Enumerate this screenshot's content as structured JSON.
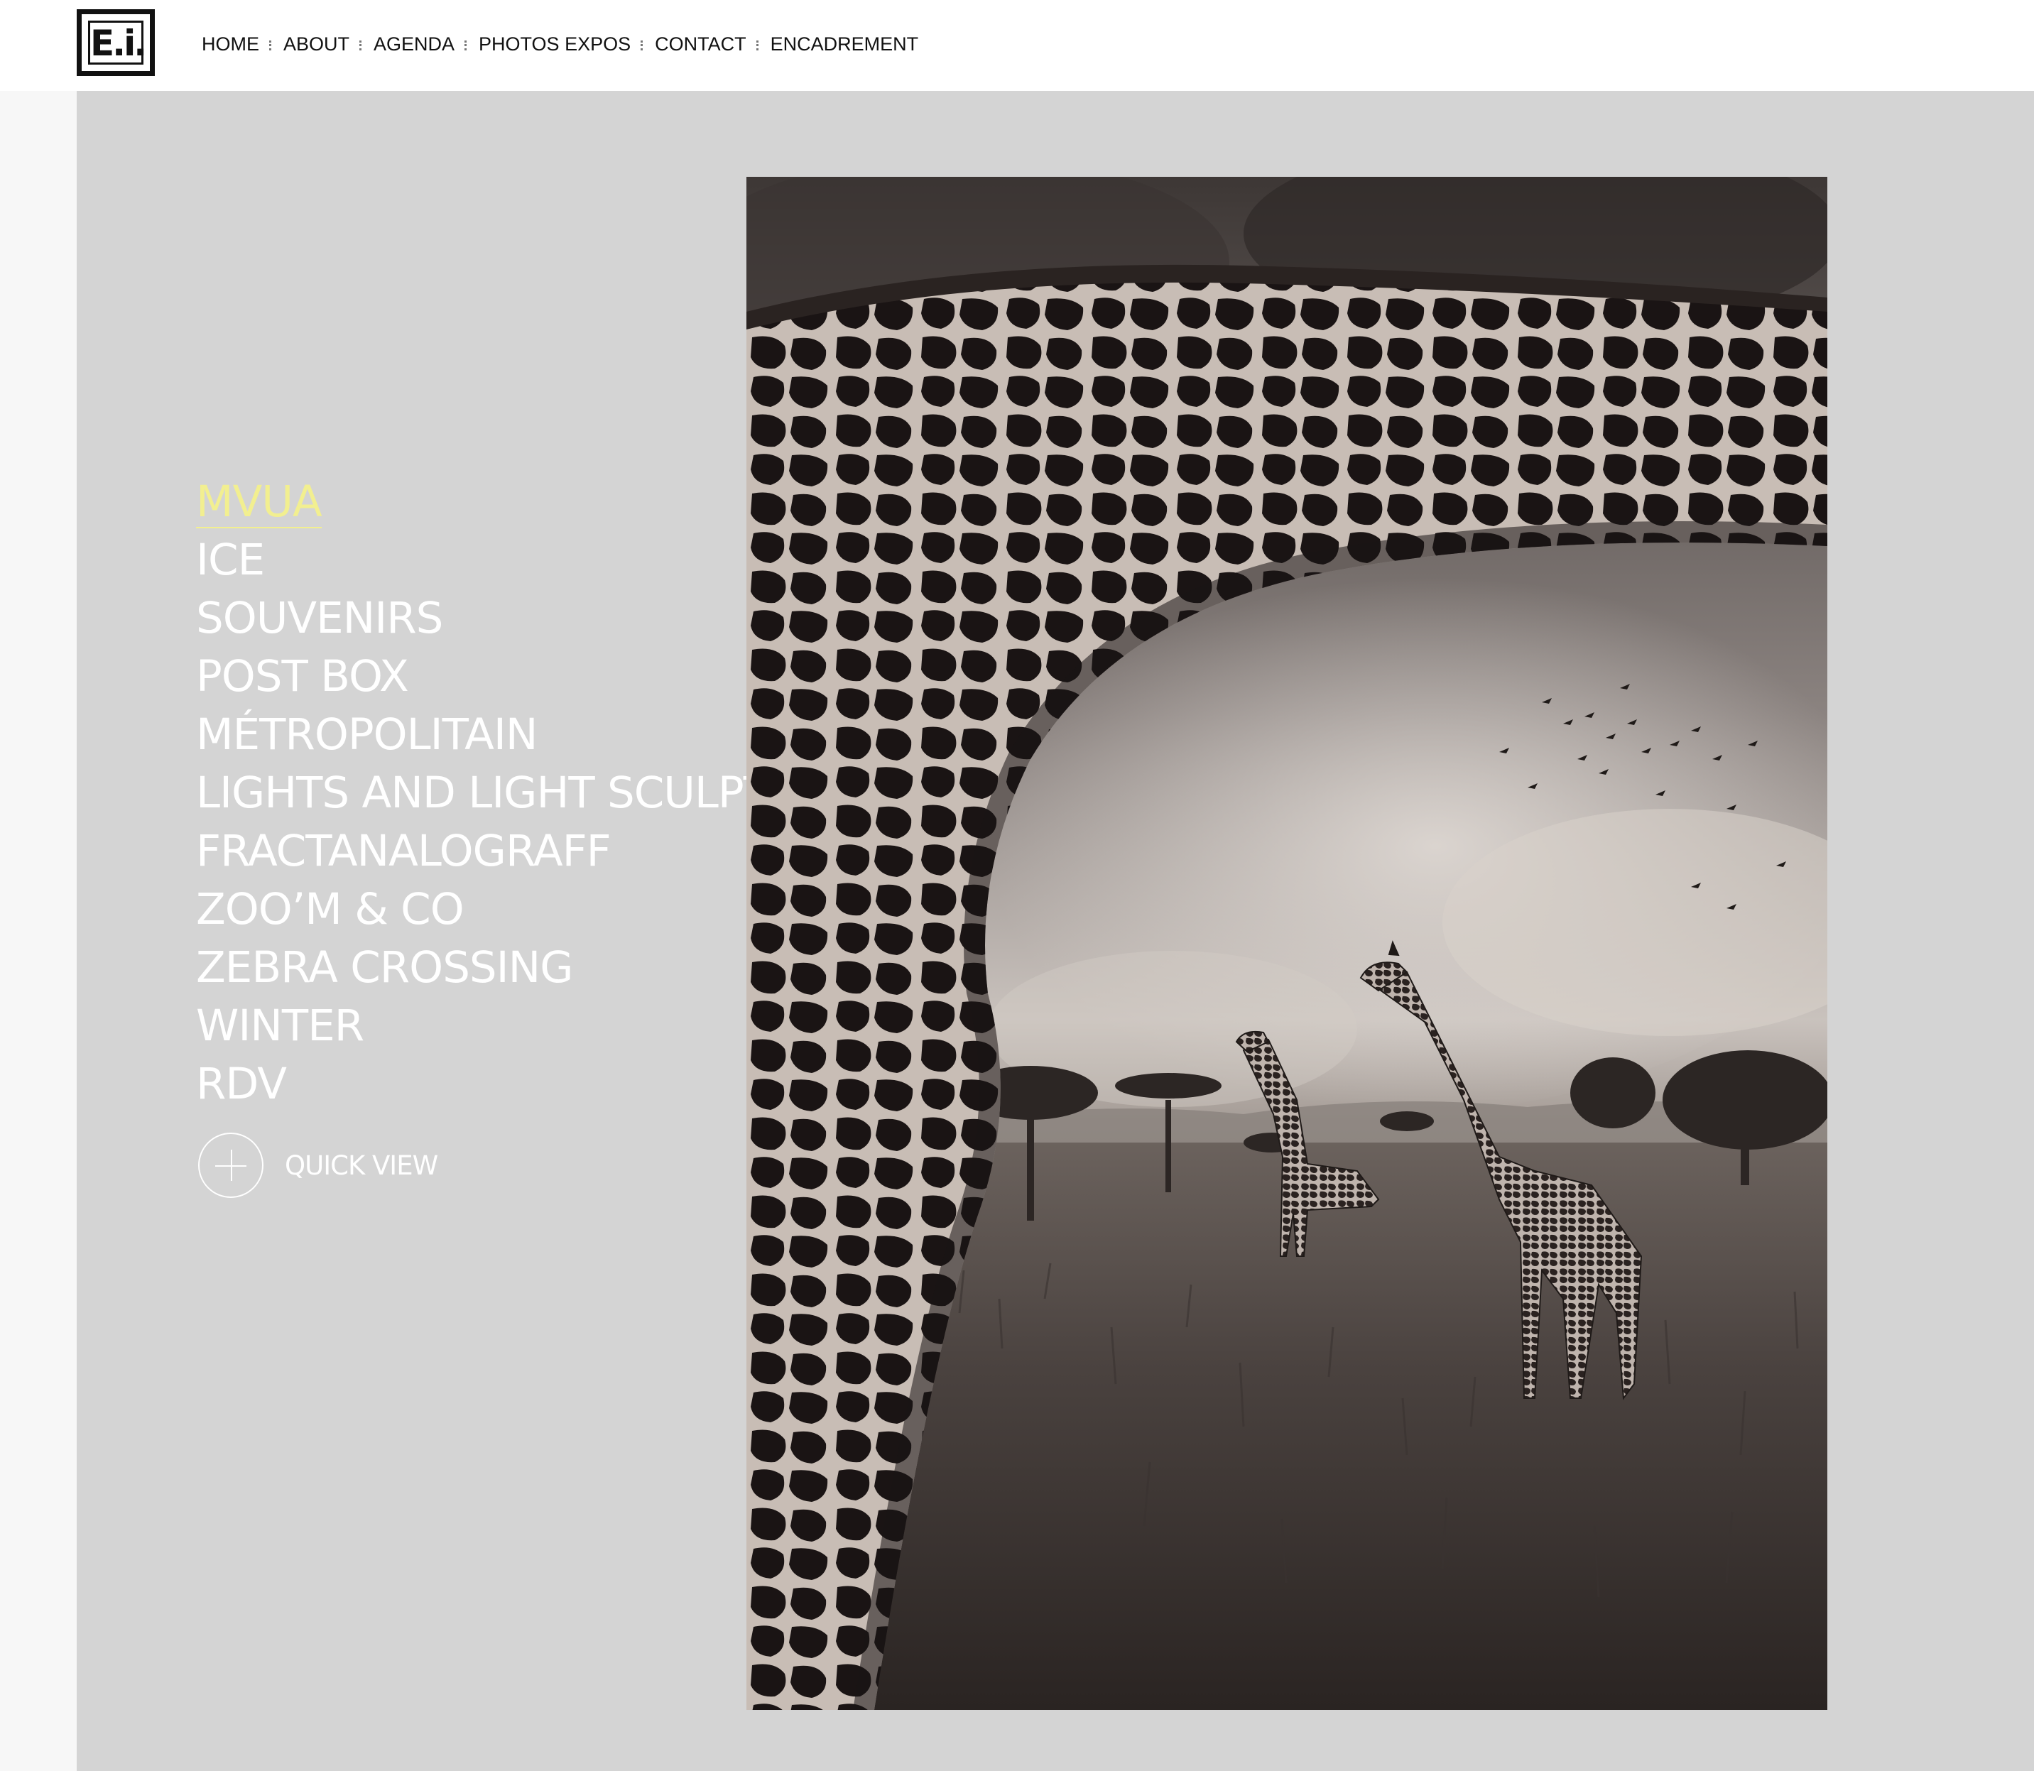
{
  "logo": {
    "text": "E.i."
  },
  "nav": {
    "items": [
      "HOME",
      "ABOUT",
      "AGENDA",
      "PHOTOS EXPOS",
      "CONTACT",
      "ENCADREMENT"
    ]
  },
  "gallery_menu": {
    "items": [
      "MVUA",
      "ICE",
      "SOUVENIRS",
      "POST BOX",
      "MÉTROPOLITAIN",
      "LIGHTS AND LIGHT SCULPTURES",
      "FRACTANALOGRAFF",
      "ZOO’M & CO",
      "ZEBRA CROSSING",
      "WINTER",
      "RDV"
    ],
    "active_index": 0
  },
  "quick_view": {
    "label": "QUICK VIEW"
  },
  "colors": {
    "panel_bg": "#d4d4d4",
    "active_item": "#f2ef90",
    "menu_text": "#ffffff",
    "header_bg": "#ffffff"
  },
  "photo": {
    "subject": "black and white giraffes in savanna"
  }
}
